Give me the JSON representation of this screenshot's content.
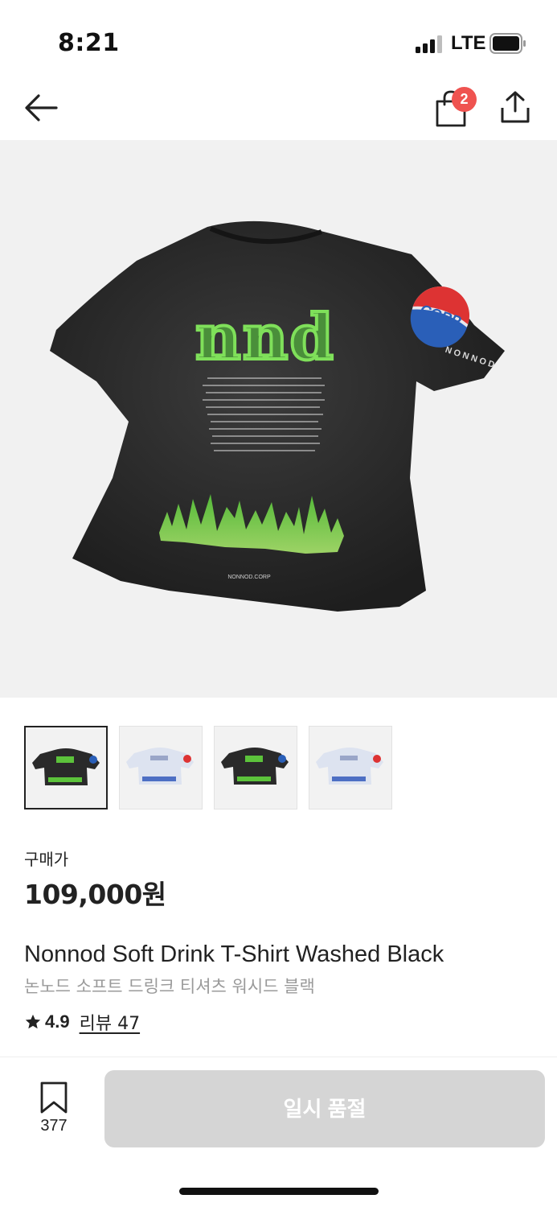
{
  "status_bar": {
    "time": "8:21",
    "network": "LTE"
  },
  "nav": {
    "cart_count": "2"
  },
  "product": {
    "price_label": "구매가",
    "price": "109,000원",
    "name_en": "Nonnod Soft Drink T-Shirt Washed Black",
    "name_ko": "논노드 소프트 드링크 티셔츠 워시드 블랙",
    "rating": "4.9",
    "reviews": "리뷰 47",
    "shirt_graphic_text": "nnd",
    "sleeve_logo_text": "CORP",
    "sleeve_brand_text": "NONNOD",
    "hem_tag_text": "NONNOD.CORP"
  },
  "thumbnails": [
    {
      "variant": "black",
      "active": true
    },
    {
      "variant": "white",
      "active": false
    },
    {
      "variant": "black",
      "active": false
    },
    {
      "variant": "white",
      "active": false
    }
  ],
  "bottom": {
    "bookmark_count": "377",
    "cta_label": "일시 품절"
  },
  "colors": {
    "badge": "#ef5350",
    "disabled_button": "#d5d5d5",
    "hero_bg": "#f1f1f1",
    "shirt": "#2b2b2b",
    "print_green": "#6fd64a"
  },
  "icons": [
    "back-arrow-icon",
    "shopping-bag-icon",
    "share-icon",
    "star-icon",
    "bookmark-icon"
  ]
}
